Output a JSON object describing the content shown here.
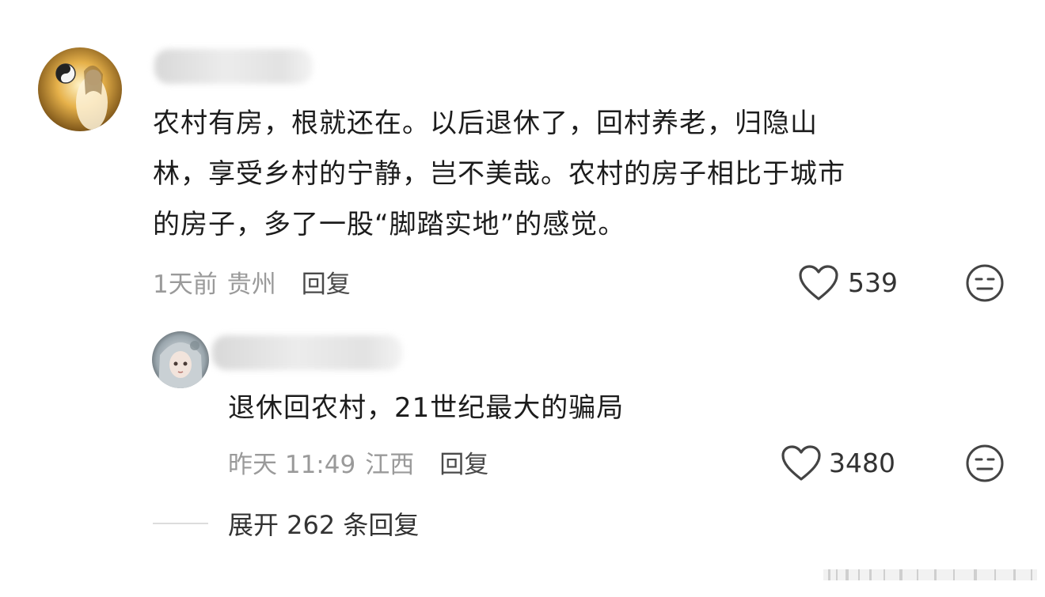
{
  "comment": {
    "text": "农村有房，根就还在。以后退休了，回村养老，归隐山林，享受乡村的宁静，岂不美哉。农村的房子相比于城市的房子，多了一股“脚踏实地”的感觉。",
    "lines": [
      "农村有房，根就还在。以后退休了，回村养老，归隐山",
      "林，享受乡村的宁静，岂不美哉。农村的房子相比于城市",
      "的房子，多了一股“脚踏实地”的感觉。"
    ],
    "time": "1天前",
    "location": "贵州",
    "reply_label": "回复",
    "likes": "539",
    "icons": {
      "like": "heart-icon",
      "dislike": "neutral-face-icon"
    }
  },
  "reply": {
    "text": "退休回农村，21世纪最大的骗局",
    "time": "昨天 11:49",
    "location": "江西",
    "reply_label": "回复",
    "likes": "3480",
    "icons": {
      "like": "heart-icon",
      "dislike": "neutral-face-icon"
    }
  },
  "expand": {
    "label": "展开 262 条回复"
  }
}
